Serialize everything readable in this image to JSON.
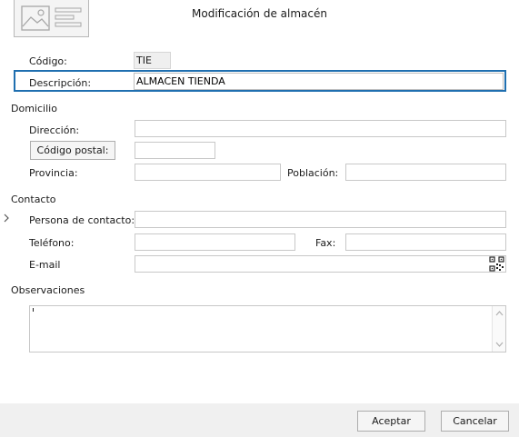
{
  "window": {
    "title": "Modificación de almacén"
  },
  "icons": {
    "logo": "image-placeholder-icon",
    "qr": "qr-code-icon",
    "row_marker": "chevron-right-icon"
  },
  "codigo": {
    "label": "Código:",
    "value": "TIE"
  },
  "descripcion": {
    "label": "Descripción:",
    "value": "ALMACEN TIENDA"
  },
  "domicilio": {
    "section": "Domicilio",
    "direccion_label": "Dirección:",
    "direccion_value": "",
    "codigo_postal_button": "Código postal:",
    "codigo_postal_value": "",
    "provincia_label": "Provincia:",
    "provincia_value": "",
    "poblacion_label": "Población:",
    "poblacion_value": ""
  },
  "contacto": {
    "section": "Contacto",
    "persona_label": "Persona de contacto:",
    "persona_value": "",
    "telefono_label": "Teléfono:",
    "telefono_value": "",
    "fax_label": "Fax:",
    "fax_value": "",
    "email_label": "E-mail",
    "email_value": ""
  },
  "observaciones": {
    "section": "Observaciones",
    "value": ""
  },
  "buttons": {
    "accept": "Aceptar",
    "cancel": "Cancelar"
  },
  "colors": {
    "focus_border": "#1f6fb0",
    "footer_bg": "#f0f0f0",
    "field_border": "#c8c8c8"
  }
}
